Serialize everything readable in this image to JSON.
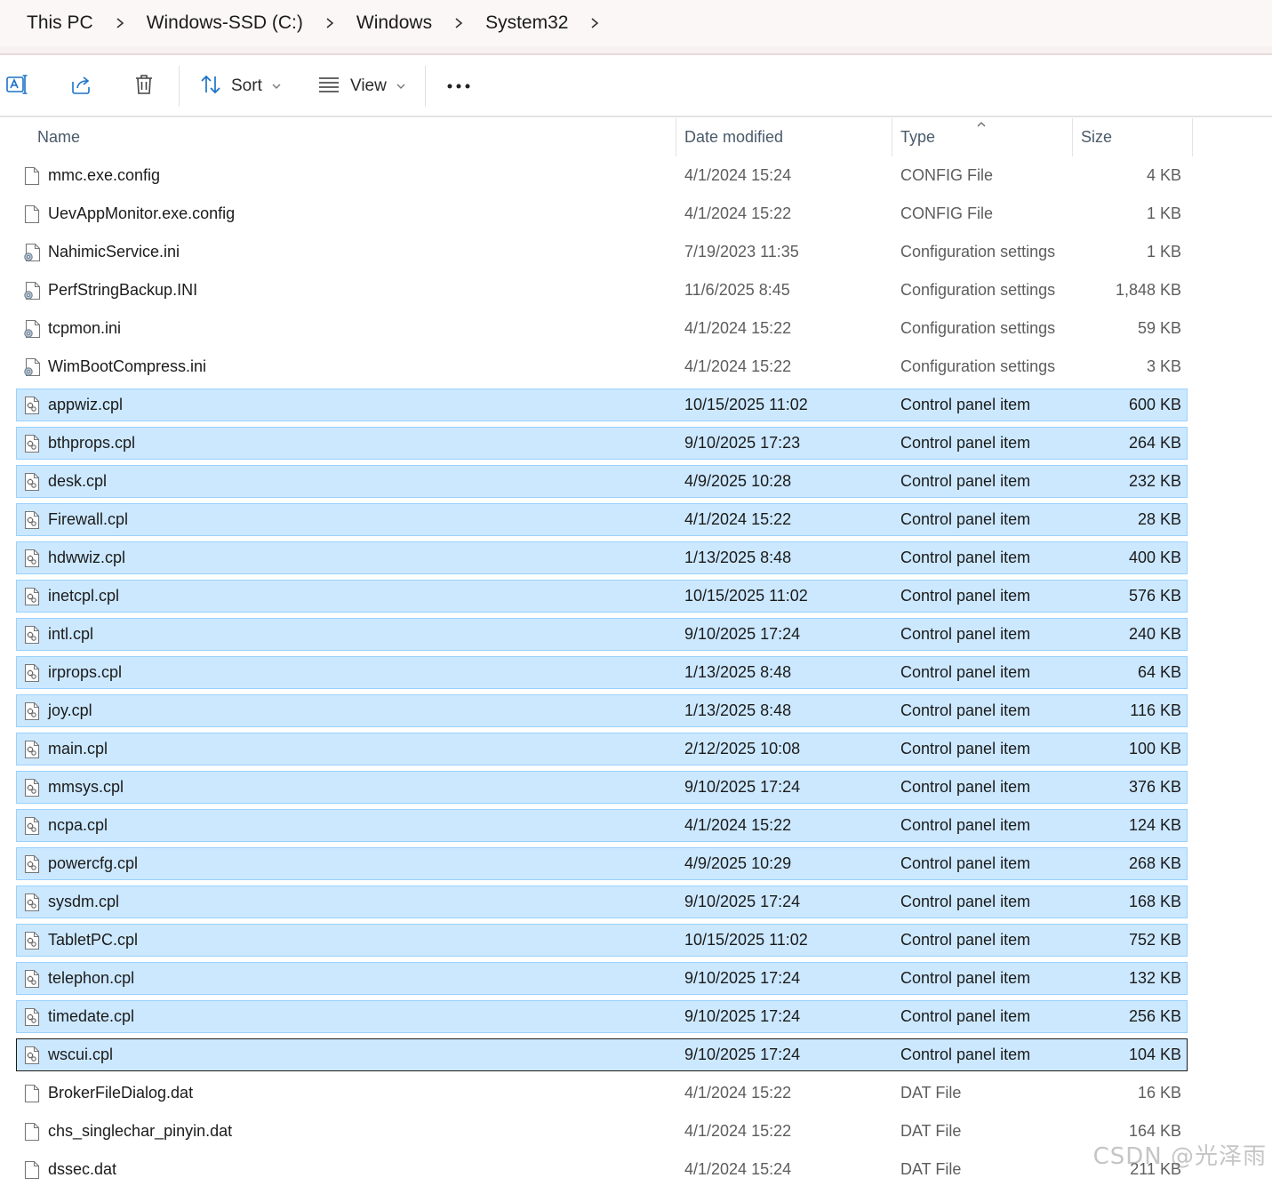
{
  "breadcrumb": [
    {
      "label": "This PC"
    },
    {
      "label": "Windows-SSD (C:)"
    },
    {
      "label": "Windows"
    },
    {
      "label": "System32"
    }
  ],
  "toolbar": {
    "sort_label": "Sort",
    "view_label": "View",
    "more_label": "•••"
  },
  "columns": {
    "name": "Name",
    "date": "Date modified",
    "type": "Type",
    "size": "Size",
    "sorted_by": "Type"
  },
  "files": [
    {
      "name": "mmc.exe.config",
      "date": "4/1/2024 15:24",
      "type": "CONFIG File",
      "size": "4 KB",
      "icon": "blank-file-icon",
      "state": "normal"
    },
    {
      "name": "UevAppMonitor.exe.config",
      "date": "4/1/2024 15:22",
      "type": "CONFIG File",
      "size": "1 KB",
      "icon": "blank-file-icon",
      "state": "normal"
    },
    {
      "name": "NahimicService.ini",
      "date": "7/19/2023 11:35",
      "type": "Configuration settings",
      "size": "1 KB",
      "icon": "settings-file-icon",
      "state": "normal"
    },
    {
      "name": "PerfStringBackup.INI",
      "date": "11/6/2025 8:45",
      "type": "Configuration settings",
      "size": "1,848 KB",
      "icon": "settings-file-icon",
      "state": "normal"
    },
    {
      "name": "tcpmon.ini",
      "date": "4/1/2024 15:22",
      "type": "Configuration settings",
      "size": "59 KB",
      "icon": "settings-file-icon",
      "state": "normal"
    },
    {
      "name": "WimBootCompress.ini",
      "date": "4/1/2024 15:22",
      "type": "Configuration settings",
      "size": "3 KB",
      "icon": "settings-file-icon",
      "state": "normal"
    },
    {
      "name": "appwiz.cpl",
      "date": "10/15/2025 11:02",
      "type": "Control panel item",
      "size": "600 KB",
      "icon": "control-panel-file-icon",
      "state": "selected"
    },
    {
      "name": "bthprops.cpl",
      "date": "9/10/2025 17:23",
      "type": "Control panel item",
      "size": "264 KB",
      "icon": "control-panel-file-icon",
      "state": "selected"
    },
    {
      "name": "desk.cpl",
      "date": "4/9/2025 10:28",
      "type": "Control panel item",
      "size": "232 KB",
      "icon": "control-panel-file-icon",
      "state": "selected"
    },
    {
      "name": "Firewall.cpl",
      "date": "4/1/2024 15:22",
      "type": "Control panel item",
      "size": "28 KB",
      "icon": "control-panel-file-icon",
      "state": "selected"
    },
    {
      "name": "hdwwiz.cpl",
      "date": "1/13/2025 8:48",
      "type": "Control panel item",
      "size": "400 KB",
      "icon": "control-panel-file-icon",
      "state": "selected"
    },
    {
      "name": "inetcpl.cpl",
      "date": "10/15/2025 11:02",
      "type": "Control panel item",
      "size": "576 KB",
      "icon": "control-panel-file-icon",
      "state": "selected"
    },
    {
      "name": "intl.cpl",
      "date": "9/10/2025 17:24",
      "type": "Control panel item",
      "size": "240 KB",
      "icon": "control-panel-file-icon",
      "state": "selected"
    },
    {
      "name": "irprops.cpl",
      "date": "1/13/2025 8:48",
      "type": "Control panel item",
      "size": "64 KB",
      "icon": "control-panel-file-icon",
      "state": "selected"
    },
    {
      "name": "joy.cpl",
      "date": "1/13/2025 8:48",
      "type": "Control panel item",
      "size": "116 KB",
      "icon": "control-panel-file-icon",
      "state": "selected"
    },
    {
      "name": "main.cpl",
      "date": "2/12/2025 10:08",
      "type": "Control panel item",
      "size": "100 KB",
      "icon": "control-panel-file-icon",
      "state": "selected"
    },
    {
      "name": "mmsys.cpl",
      "date": "9/10/2025 17:24",
      "type": "Control panel item",
      "size": "376 KB",
      "icon": "control-panel-file-icon",
      "state": "selected"
    },
    {
      "name": "ncpa.cpl",
      "date": "4/1/2024 15:22",
      "type": "Control panel item",
      "size": "124 KB",
      "icon": "control-panel-file-icon",
      "state": "selected"
    },
    {
      "name": "powercfg.cpl",
      "date": "4/9/2025 10:29",
      "type": "Control panel item",
      "size": "268 KB",
      "icon": "control-panel-file-icon",
      "state": "selected"
    },
    {
      "name": "sysdm.cpl",
      "date": "9/10/2025 17:24",
      "type": "Control panel item",
      "size": "168 KB",
      "icon": "control-panel-file-icon",
      "state": "selected"
    },
    {
      "name": "TabletPC.cpl",
      "date": "10/15/2025 11:02",
      "type": "Control panel item",
      "size": "752 KB",
      "icon": "control-panel-file-icon",
      "state": "selected"
    },
    {
      "name": "telephon.cpl",
      "date": "9/10/2025 17:24",
      "type": "Control panel item",
      "size": "132 KB",
      "icon": "control-panel-file-icon",
      "state": "selected"
    },
    {
      "name": "timedate.cpl",
      "date": "9/10/2025 17:24",
      "type": "Control panel item",
      "size": "256 KB",
      "icon": "control-panel-file-icon",
      "state": "selected"
    },
    {
      "name": "wscui.cpl",
      "date": "9/10/2025 17:24",
      "type": "Control panel item",
      "size": "104 KB",
      "icon": "control-panel-file-icon",
      "state": "focused"
    },
    {
      "name": "BrokerFileDialog.dat",
      "date": "4/1/2024 15:22",
      "type": "DAT File",
      "size": "16 KB",
      "icon": "blank-file-icon",
      "state": "normal"
    },
    {
      "name": "chs_singlechar_pinyin.dat",
      "date": "4/1/2024 15:22",
      "type": "DAT File",
      "size": "164 KB",
      "icon": "blank-file-icon",
      "state": "normal"
    },
    {
      "name": "dssec.dat",
      "date": "4/1/2024 15:24",
      "type": "DAT File",
      "size": "211 KB",
      "icon": "blank-file-icon",
      "state": "normal"
    }
  ],
  "watermark": "CSDN @光泽雨",
  "colors": {
    "selection_bg": "#cce8ff",
    "selection_border": "#99d1ff",
    "focus_border": "#1b1b1b",
    "accent": "#0067c0"
  }
}
